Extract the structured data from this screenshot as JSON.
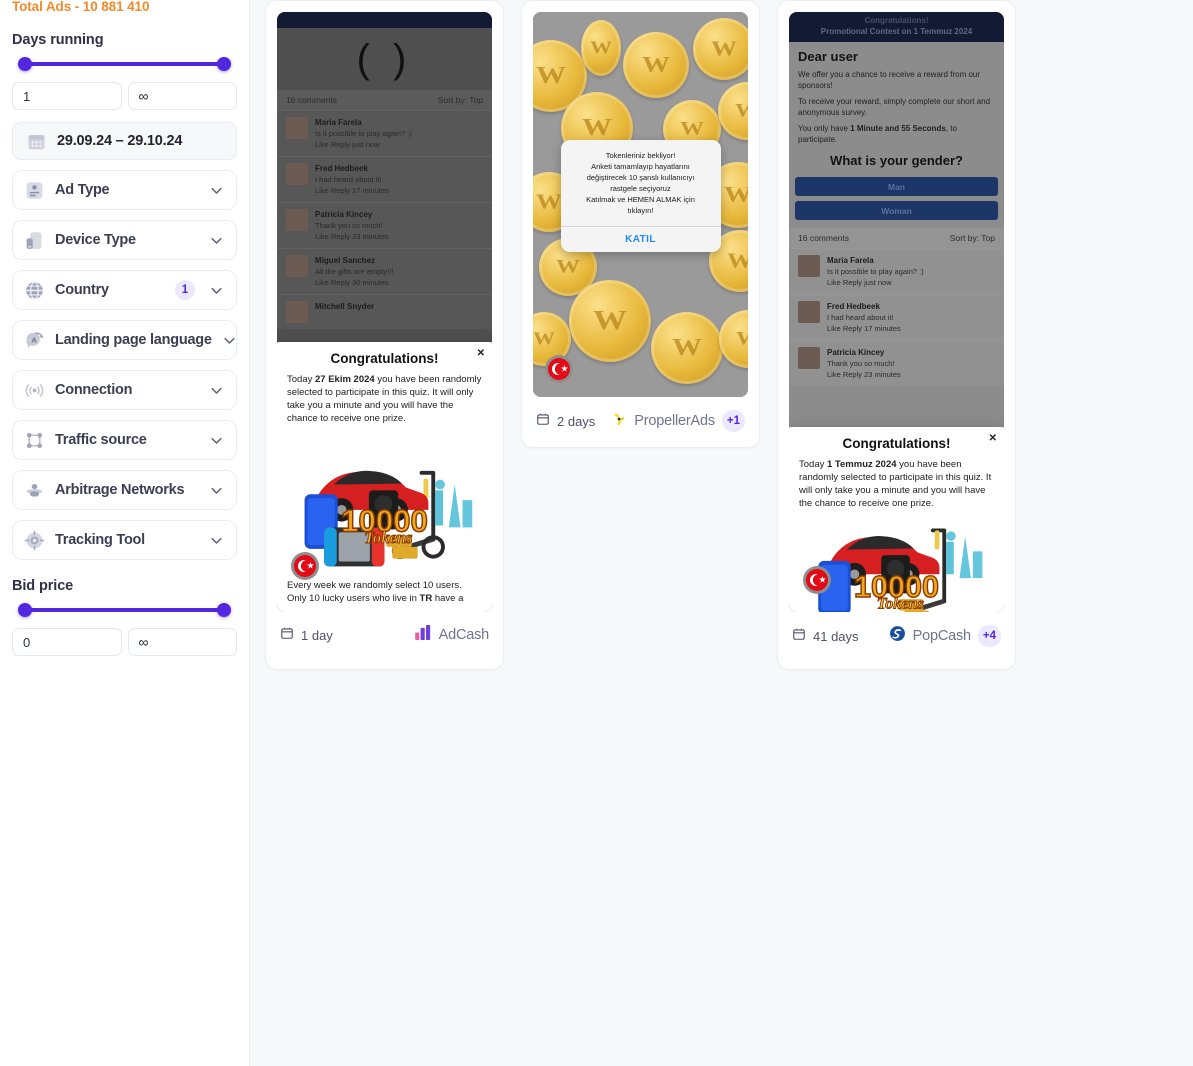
{
  "sidebar": {
    "total_ads": "Total Ads - 10 881 410",
    "days_running": {
      "title": "Days running",
      "min_value": "1",
      "max_value": "∞"
    },
    "date_range": "29.09.24 – 29.10.24",
    "filters": [
      {
        "label": "Ad Type",
        "icon": "ad-type-icon",
        "badge": ""
      },
      {
        "label": "Device Type",
        "icon": "device-type-icon",
        "badge": ""
      },
      {
        "label": "Country",
        "icon": "globe-icon",
        "badge": "1"
      },
      {
        "label": "Landing page language",
        "icon": "translate-icon",
        "badge": ""
      },
      {
        "label": "Connection",
        "icon": "connection-icon",
        "badge": ""
      },
      {
        "label": "Traffic source",
        "icon": "traffic-source-icon",
        "badge": ""
      },
      {
        "label": "Arbitrage Networks",
        "icon": "arbitrage-networks-icon",
        "badge": ""
      },
      {
        "label": "Tracking Tool",
        "icon": "tracking-tool-icon",
        "badge": ""
      }
    ],
    "bid_price": {
      "title": "Bid price",
      "min_value": "0",
      "max_value": "∞"
    }
  },
  "accent_colors": {
    "slider": "#5227e0",
    "badge_bg": "#ece8fd",
    "badge_text": "#5227e0",
    "total_ads": "#f08a2a",
    "katil_link": "#1f8cf0"
  },
  "cards": [
    {
      "id": "card-adcash",
      "days": "1 day",
      "network": "AdCash",
      "network_icon": "adcash-bars-icon",
      "extra_networks": "",
      "creative": {
        "type": "comments-feed",
        "emoji": "( )",
        "comments_header": "16 comments",
        "sort_label": "Sort by:  Top",
        "comments": [
          {
            "name": "Maria Farela",
            "text": "Is it possible to play again? :)",
            "meta": "Like Reply  just now"
          },
          {
            "name": "Fred Hedbeek",
            "text": "I had heard about it!",
            "meta": "Like Reply  17 minutes"
          },
          {
            "name": "Patricia Kincey",
            "text": "Thank you so much!",
            "meta": "Like Reply  23 minutes"
          },
          {
            "name": "Miguel Sanchez",
            "text": "All the gifts are empty!!!",
            "meta": "Like Reply  30 minutes"
          },
          {
            "name": "Mitchell Snyder",
            "text": "",
            "meta": ""
          }
        ],
        "popup": {
          "title": "Congratulations!",
          "close": "✕",
          "body_pre": "Today ",
          "body_date": "27 Ekim 2024",
          "body_post": " you have been randomly selected to participate in this quiz. It will only take you a minute and you will have the chance to receive one prize.",
          "tail_pre": "Every week we randomly select 10 users. Only 10 lucky users who live in ",
          "tail_country": "TR",
          "tail_post": " have a",
          "prize_label": "10000 Tokens"
        },
        "flag": "turkey-flag-icon"
      }
    },
    {
      "id": "card-propellerads",
      "days": "2 days",
      "network": "PropellerAds",
      "network_icon": "propellerads-icon",
      "extra_networks": "+1",
      "creative": {
        "type": "coins-dialog",
        "dialog_lines": [
          "Tokenleriniz bekliyor!",
          "Anketi tamamlayıp hayatlarını",
          "değiştirecek 10 şanslı kullanıcıyı",
          "rastgele seçiyoruz",
          "Katılmak ve HEMEN ALMAK için",
          "tıklayın!"
        ],
        "dialog_button": "KATIL",
        "flag": "turkey-flag-icon"
      }
    },
    {
      "id": "card-popcash",
      "days": "41 days",
      "network": "PopCash",
      "network_icon": "popcash-icon",
      "extra_networks": "+4",
      "creative": {
        "type": "survey-feed",
        "banner_title": "Congratulations!",
        "banner_sub_pre": "Promotional Contest on ",
        "banner_sub_date": "1 Temmuz 2024",
        "heading": "Dear user",
        "para1": "We offer you a chance to receive a reward from our sponsors!",
        "para2": "To receive your reward, simply complete our short and anonymous survey.",
        "para3_pre": "You only have ",
        "para3_bold": "1 Minute and 55 Seconds",
        "para3_post": ", to participate.",
        "question": "What is your gender?",
        "options": [
          "Man",
          "Woman"
        ],
        "comments_header": "16 comments",
        "sort_label": "Sort by:  Top",
        "comments": [
          {
            "name": "Maria Farela",
            "text": "Is it possible to play again? :)",
            "meta": "Like Reply  just now"
          },
          {
            "name": "Fred Hedbeek",
            "text": "I had heard about it!",
            "meta": "Like Reply  17 minutes"
          },
          {
            "name": "Patricia Kincey",
            "text": "Thank you so much!",
            "meta": "Like Reply  23 minutes"
          }
        ],
        "popup": {
          "title": "Congratulations!",
          "close": "✕",
          "body_pre": "Today ",
          "body_date": "1 Temmuz 2024",
          "body_post": " you have been randomly selected to participate in this quiz. It will only take you a minute and you will have the chance to receive one prize.",
          "prize_label": "10000 Tokens"
        },
        "flag": "turkey-flag-icon"
      }
    }
  ]
}
